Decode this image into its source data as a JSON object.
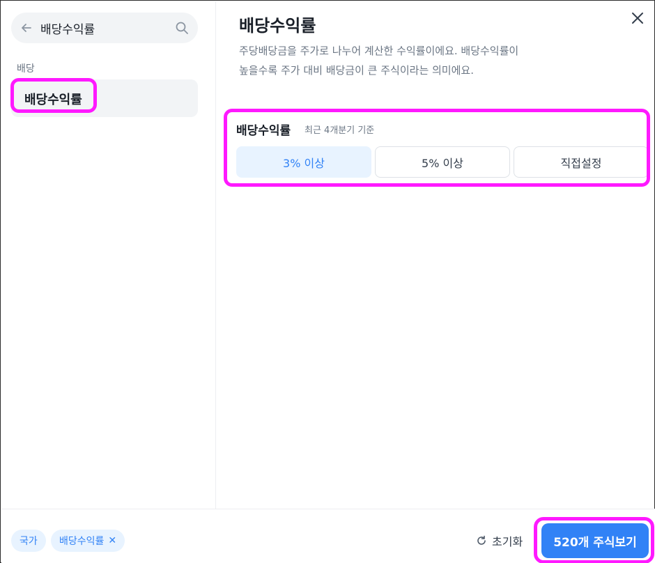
{
  "search": {
    "query": "배당수익률"
  },
  "sidebar": {
    "category_label": "배당",
    "items": [
      {
        "label": "배당수익률",
        "selected": true
      }
    ]
  },
  "panel": {
    "title": "배당수익률",
    "description_line1": "주당배당금을 주가로 나누어 계산한 수익률이에요. 배당수익률이",
    "description_line2": "높을수록 주가 대비 배당금이 큰 주식이라는 의미에요."
  },
  "filter": {
    "name": "배당수익률",
    "subtitle": "최근 4개분기 기준",
    "options": [
      {
        "label": "3% 이상",
        "selected": true
      },
      {
        "label": "5% 이상",
        "selected": false
      },
      {
        "label": "직접설정",
        "selected": false
      }
    ]
  },
  "footer": {
    "chips": [
      {
        "label": "국가"
      },
      {
        "label": "배당수익률",
        "removable": true
      }
    ],
    "reset_label": "초기화",
    "cta_label": "520개 주식보기"
  },
  "colors": {
    "accent": "#3182f6",
    "accent_light": "#e8f3ff",
    "highlight": "#ff19ff",
    "text_primary": "#191f28",
    "text_secondary": "#6b7684"
  },
  "icons": {
    "back": "arrow-left-icon",
    "search": "search-icon",
    "close": "close-icon",
    "reset": "refresh-icon",
    "chip_remove": "close-icon"
  }
}
